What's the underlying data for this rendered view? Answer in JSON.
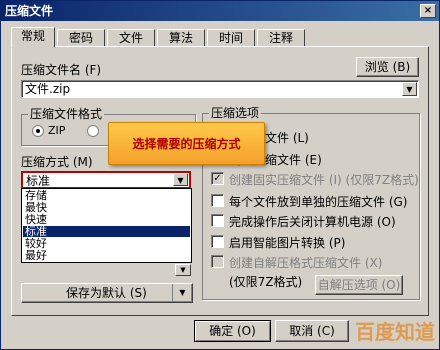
{
  "window": {
    "title": "压缩文件",
    "close_glyph": "×"
  },
  "tabs": [
    {
      "label": "常规"
    },
    {
      "label": "密码"
    },
    {
      "label": "文件"
    },
    {
      "label": "算法"
    },
    {
      "label": "时间"
    },
    {
      "label": "注释"
    }
  ],
  "general": {
    "filename_label": "压缩文件名 (F)",
    "filename_value": "文件.zip",
    "browse_label": "浏览 (B)",
    "format_group_title": "压缩文件格式",
    "format_zip_label": "ZIP",
    "method_label": "压缩方式 (M)",
    "method_value": "标准",
    "method_options": [
      "存储",
      "最快",
      "快速",
      "标准",
      "较好",
      "最好"
    ],
    "method_selected": "标准",
    "save_default_label": "保存为默认 (S)",
    "options_group_title": "压缩选项",
    "options": [
      {
        "label": "删除源文件 (L)",
        "checked": false,
        "enabled": true
      },
      {
        "label": "测试压缩文件 (E)",
        "checked": false,
        "enabled": true
      },
      {
        "label": "创建固实压缩文件 (I) (仅限7Z格式)",
        "checked": true,
        "enabled": false
      },
      {
        "label": "每个文件放到单独的压缩文件 (G)",
        "checked": false,
        "enabled": true
      },
      {
        "label": "完成操作后关闭计算机电源 (O)",
        "checked": false,
        "enabled": true
      },
      {
        "label": "启用智能图片转换 (P)",
        "checked": false,
        "enabled": true
      },
      {
        "label": "创建自解压格式压缩文件 (X)",
        "checked": false,
        "enabled": false
      }
    ],
    "sfx_note": "(仅限7Z格式)",
    "sfx_options_label": "自解压选项 (O)"
  },
  "tooltip": {
    "text": "选择需要的压缩方式"
  },
  "footer": {
    "ok_label": "确定 (O)",
    "cancel_label": "取消 (C)"
  },
  "watermark": {
    "text": "百度知道"
  }
}
